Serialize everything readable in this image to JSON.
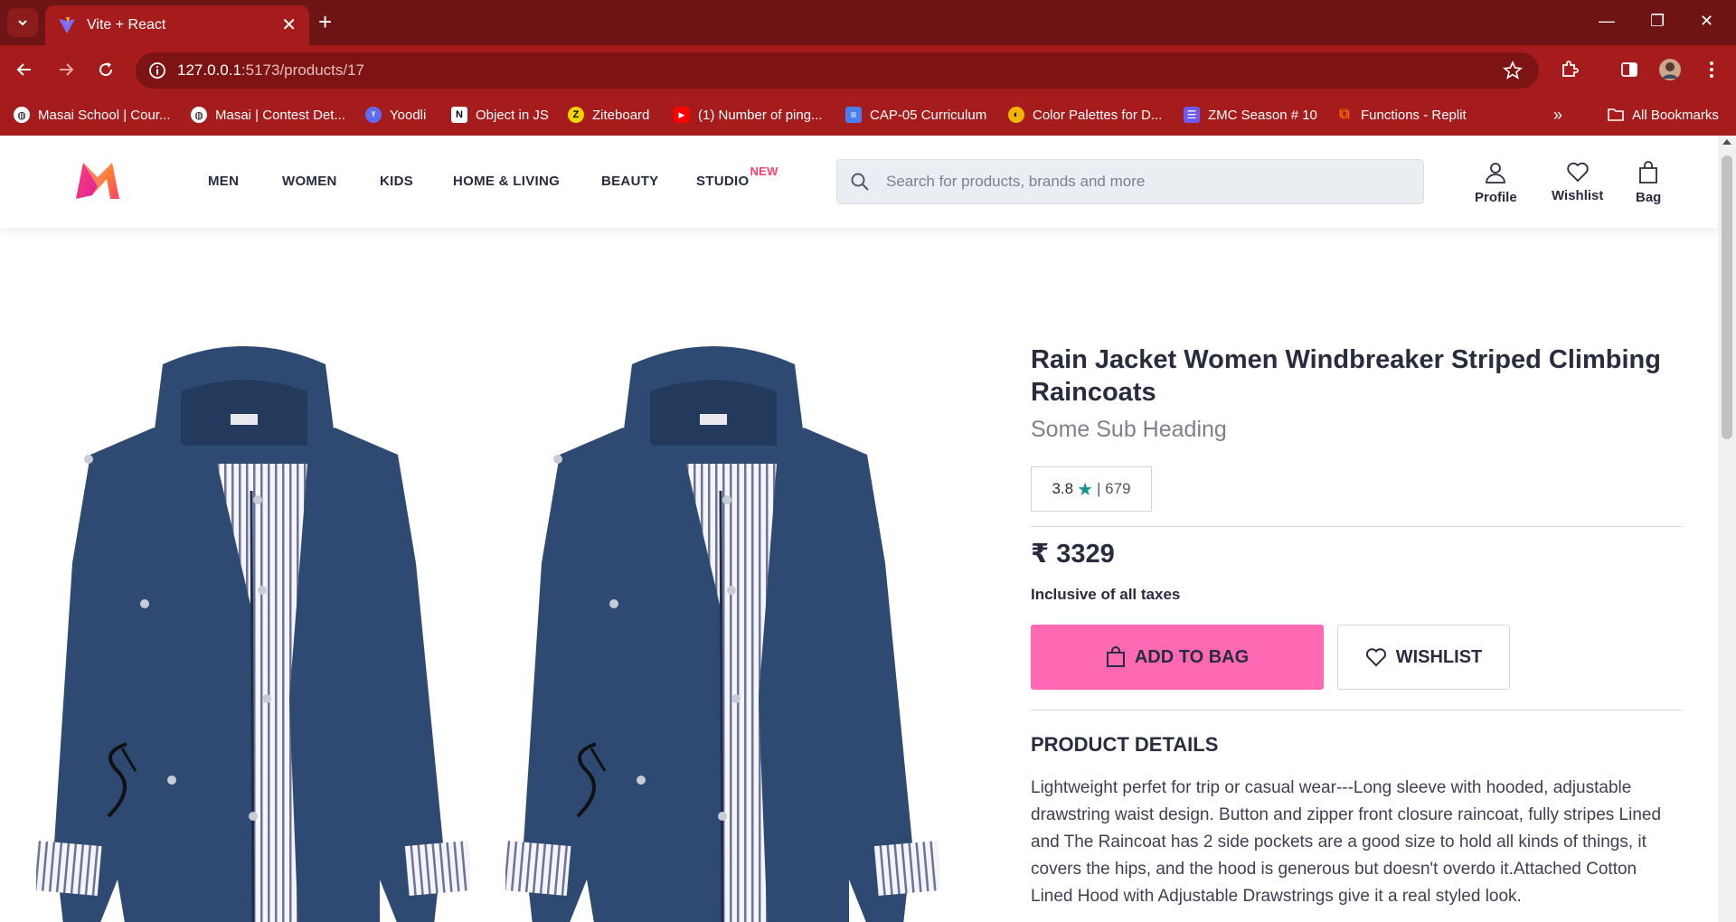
{
  "browser": {
    "tab_title": "Vite + React",
    "url_host": "127.0.0.1",
    "url_path": ":5173/products/17",
    "bookmarks": [
      {
        "label": "Masai School | Cour...",
        "icon": "globe-icon",
        "color": "#ffffff"
      },
      {
        "label": "Masai | Contest Det...",
        "icon": "globe-icon",
        "color": "#ffffff"
      },
      {
        "label": "Yoodli",
        "icon": "yoodli-icon",
        "color": "#5b6cf0"
      },
      {
        "label": "Object in JS",
        "icon": "notion-icon",
        "color": "#ffffff"
      },
      {
        "label": "Ziteboard",
        "icon": "ziteboard-icon",
        "color": "#f5d300"
      },
      {
        "label": "(1) Number of ping...",
        "icon": "youtube-icon",
        "color": "#ff0000"
      },
      {
        "label": "CAP-05 Curriculum",
        "icon": "docs-icon",
        "color": "#4a7df2"
      },
      {
        "label": "Color Palettes for D...",
        "icon": "palette-icon",
        "color": "#f2b600"
      },
      {
        "label": "ZMC Season # 10",
        "icon": "list-icon",
        "color": "#6a5cf0"
      },
      {
        "label": "Functions - Replit",
        "icon": "replit-icon",
        "color": "#f26207"
      }
    ],
    "all_bookmarks_label": "All Bookmarks"
  },
  "header": {
    "nav": [
      "MEN",
      "WOMEN",
      "KIDS",
      "HOME & LIVING",
      "BEAUTY",
      "STUDIO"
    ],
    "studio_badge": "NEW",
    "search_placeholder": "Search for products, brands and more",
    "profile_label": "Profile",
    "wishlist_label": "Wishlist",
    "bag_label": "Bag",
    "brand_colors": {
      "primary": "#ff3f6c",
      "orange": "#ff8a00",
      "magenta": "#e0219e"
    }
  },
  "product": {
    "title": "Rain Jacket Women Windbreaker Striped Climbing Raincoats",
    "subtitle": "Some Sub Heading",
    "rating": "3.8",
    "rating_count": "679",
    "price": "₹ 3329",
    "tax_note": "Inclusive of all taxes",
    "add_to_bag": "ADD TO BAG",
    "wishlist": "WISHLIST",
    "details_heading": "PRODUCT DETAILS",
    "details_text": "Lightweight perfet for trip or casual wear---Long sleeve with hooded, adjustable drawstring waist design. Button and zipper front closure raincoat, fully stripes Lined and The Raincoat has 2 side pockets are a good size to hold all kinds of things, it covers the hips, and the hood is generous but doesn't overdo it.Attached Cotton Lined Hood with Adjustable Drawstrings give it a real styled look.",
    "jacket_color": "#2e4a72",
    "accent_button_color": "#ff69b4"
  }
}
